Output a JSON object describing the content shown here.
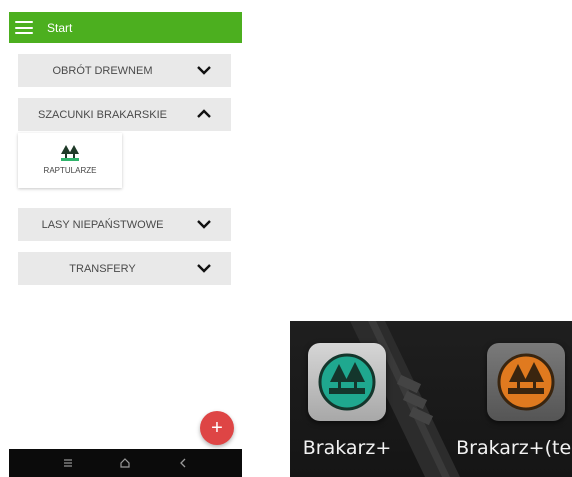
{
  "appbar": {
    "title": "Start",
    "menu_icon": "hamburger-menu-icon"
  },
  "sections": [
    {
      "label": "OBRÓT DREWNEM",
      "expanded": false,
      "icon": "chevron-down-icon"
    },
    {
      "label": "SZACUNKI BRAKARSKIE",
      "expanded": true,
      "icon": "chevron-up-icon"
    },
    {
      "label": "LASY NIEPAŃSTWOWE",
      "expanded": false,
      "icon": "chevron-down-icon"
    },
    {
      "label": "TRANSFERY",
      "expanded": false,
      "icon": "chevron-down-icon"
    }
  ],
  "tile": {
    "label": "RAPTULARZE",
    "icon": "forest-trees-icon"
  },
  "fab": {
    "label": "+",
    "color": "#de4545"
  },
  "navbar": {
    "icons": [
      "menu-lines-icon",
      "home-icon",
      "back-icon"
    ]
  },
  "launcher": {
    "apps": [
      {
        "label": "Brakarz+",
        "icon": "brakarz-app-icon",
        "accent": "#1fa88f",
        "frame": "#bfbfbf"
      },
      {
        "label": "Brakarz+(test)",
        "icon": "brakarz-test-app-icon",
        "accent": "#e07a1f",
        "frame": "#6a6a6a"
      }
    ]
  },
  "colors": {
    "appbar": "#4caf1f",
    "section_bg": "#e9e9e9"
  }
}
